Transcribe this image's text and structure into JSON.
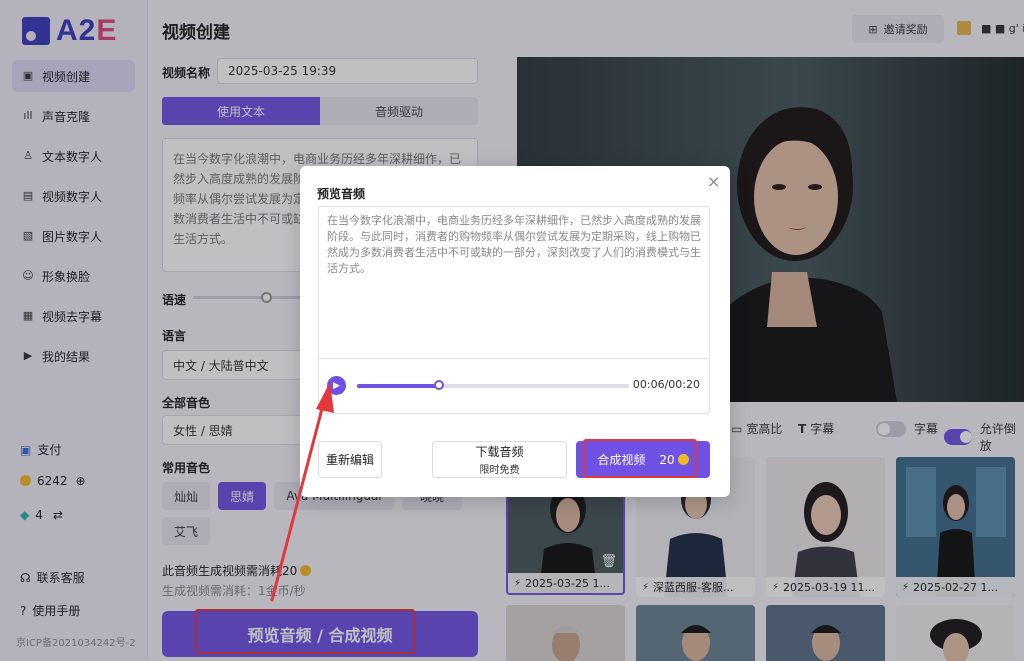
{
  "logo": {
    "text_a": "A2",
    "text_e": "E"
  },
  "sidebar": {
    "items": [
      {
        "label": "视频创建",
        "icon": "video-icon"
      },
      {
        "label": "声音克隆",
        "icon": "waveform-icon"
      },
      {
        "label": "文本数字人",
        "icon": "person-text-icon"
      },
      {
        "label": "视频数字人",
        "icon": "person-video-icon"
      },
      {
        "label": "图片数字人",
        "icon": "image-icon"
      },
      {
        "label": "形象换脸",
        "icon": "face-swap-icon"
      },
      {
        "label": "视频去字幕",
        "icon": "subtitle-remove-icon"
      },
      {
        "label": "我的结果",
        "icon": "results-icon"
      }
    ],
    "pay": "支付",
    "coins": "6242",
    "gems": "4",
    "support": "联系客服",
    "manual": "使用手册",
    "icp": "京ICP备2021034242号-2"
  },
  "main": {
    "title": "视频创建",
    "name_label": "视频名称",
    "name_value": "2025-03-25 19:39",
    "tabs": [
      "使用文本",
      "音频驱动"
    ],
    "text": "在当今数字化浪潮中，电商业务历经多年深耕细作，已然步入高度成熟的发展阶段。与此同时，消费者的购物频率从偶尔尝试发展为定期采购，线上购物已然成为多数消费者生活中不可或缺的一部分，深刻改变了人们的生活方式。",
    "speed_label": "语速",
    "language_label": "语言",
    "language_value": "中文 / 大陆普中文",
    "all_voice_label": "全部音色",
    "all_voice_value": "女性 / 思婧",
    "common_voice_label": "常用音色",
    "voices": [
      "灿灿",
      "思婧",
      "Ava Multilingual",
      "晓晓",
      "艾飞"
    ],
    "cost_note": "此音频生成视频需消耗20",
    "cost_rate": "生成视频需消耗：1金币/秒",
    "primary_button": "预览音频 / 合成视频"
  },
  "right": {
    "invite": "邀请奖励",
    "user": "■ ■ g' ia",
    "aspect": "宽高比",
    "subtitle_opt": "字幕",
    "subtitle_toggle": "字幕",
    "allow_toggle": "允许倒放",
    "thumbs": [
      {
        "label": "2025-03-25 1..."
      },
      {
        "label": "深蓝西服-客服..."
      },
      {
        "label": "2025-03-19 11..."
      },
      {
        "label": "2025-02-27 1..."
      }
    ]
  },
  "modal": {
    "title": "预览音频",
    "text": "在当今数字化浪潮中，电商业务历经多年深耕细作，已然步入高度成熟的发展阶段。与此同时，消费者的购物频率从偶尔尝试发展为定期采购，线上购物已然成为多数消费者生活中不可或缺的一部分，深刻改变了人们的消费模式与生活方式。",
    "time": "00:06/00:20",
    "progress": 0.3,
    "btn_edit": "重新编辑",
    "btn_download": "下载音频",
    "btn_download_sub": "限时免费",
    "btn_compose": "合成视频",
    "btn_compose_cost": "20",
    "close": "×"
  },
  "colors": {
    "accent": "#6f52e4",
    "highlight": "#e0383b",
    "coin": "#f1b928"
  }
}
